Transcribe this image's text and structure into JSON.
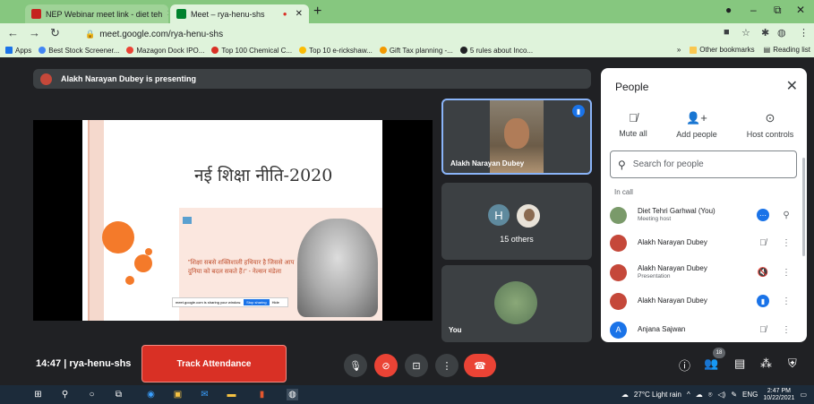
{
  "browser": {
    "tabs": [
      {
        "label": "NEP Webinar meet link - diet teh",
        "favicon_color": "#c5221f"
      },
      {
        "label": "Meet – rya-henu-shs",
        "favicon_color": "#00832d"
      }
    ],
    "url": "meet.google.com/rya-henu-shs",
    "bookmarks": [
      {
        "label": "Apps",
        "color": "#1a73e8"
      },
      {
        "label": "Best Stock Screener...",
        "color": "#4285f4"
      },
      {
        "label": "Mazagon Dock IPO...",
        "color": "#ea4335"
      },
      {
        "label": "Top 100 Chemical C...",
        "color": "#d93025"
      },
      {
        "label": "Top 10 e-rickshaw...",
        "color": "#fbbc04"
      },
      {
        "label": "Gift Tax planning -...",
        "color": "#f29900"
      },
      {
        "label": "5 rules about Inco...",
        "color": "#202124"
      }
    ],
    "bookmarks_overflow": "»",
    "other_bookmarks": "Other bookmarks",
    "reading_list": "Reading list"
  },
  "meet": {
    "presenting_banner": "Alakh Narayan Dubey is presenting",
    "slide": {
      "title": "नई शिक्षा नीति-2020",
      "quote": "\"शिक्षा सबसे शक्तिशाली हथियार है जिससे आप दुनिया को बदल सकते हैं।\" - नेल्सन मंडेला",
      "share_bar_text": "meet.google.com is sharing your window.",
      "share_bar_stop": "Stop sharing",
      "share_bar_hide": "Hide"
    },
    "tiles": {
      "presenter_name": "Alakh Narayan Dubey",
      "others_initial": "H",
      "others_label": "15 others",
      "self_label": "You"
    },
    "meeting_time": "14:47",
    "meeting_code": "rya-henu-shs",
    "track_attendance": "Track Attendance",
    "participant_badge": "18"
  },
  "people_panel": {
    "title": "People",
    "actions": [
      {
        "label": "Mute all",
        "icon": "mic-off-icon"
      },
      {
        "label": "Add people",
        "icon": "add-person-icon"
      },
      {
        "label": "Host controls",
        "icon": "toggle-icon"
      }
    ],
    "search_placeholder": "Search for people",
    "section_label": "In call",
    "participants": [
      {
        "name": "Diet Tehri Garhwal (You)",
        "sub": "Meeting host",
        "avatar_color": "#7a9a6a",
        "status": "more",
        "extra": "pin"
      },
      {
        "name": "Alakh Narayan Dubey",
        "sub": "",
        "avatar_color": "#c5483a",
        "status": "muted",
        "extra": "menu"
      },
      {
        "name": "Alakh Narayan Dubey",
        "sub": "Presentation",
        "avatar_color": "#c5483a",
        "status": "presenting",
        "extra": "menu"
      },
      {
        "name": "Alakh Narayan Dubey",
        "sub": "",
        "avatar_color": "#c5483a",
        "status": "speaking",
        "extra": "menu"
      },
      {
        "name": "Anjana Sajwan",
        "sub": "",
        "avatar_color": "#1a73e8",
        "initial": "A",
        "status": "muted",
        "extra": "menu"
      }
    ]
  },
  "taskbar": {
    "weather": "27°C  Light rain",
    "language": "ENG",
    "time": "2:47 PM",
    "date": "10/22/2021"
  }
}
